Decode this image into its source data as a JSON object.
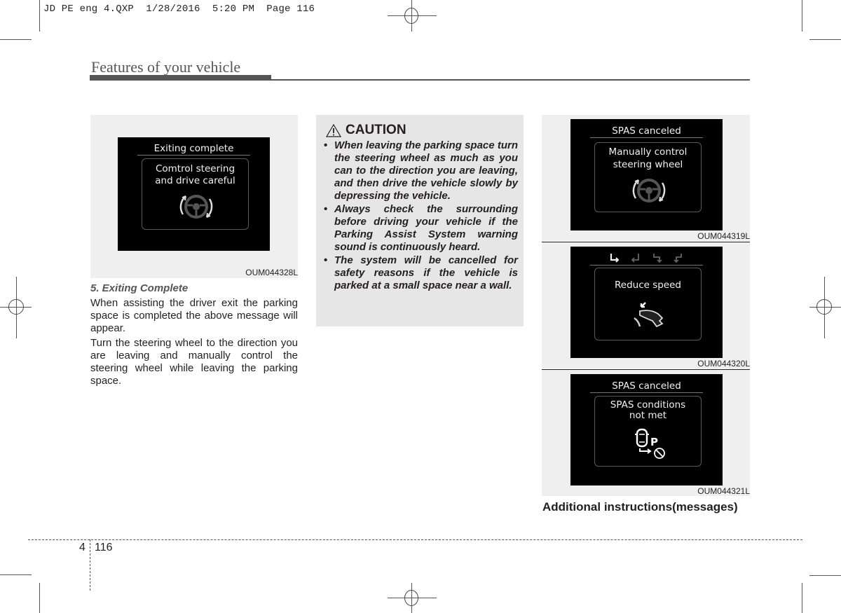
{
  "slug": "JD PE eng 4.QXP  1/28/2016  5:20 PM  Page 116",
  "header": {
    "section_title": "Features of your vehicle"
  },
  "left_column": {
    "figure": {
      "screen_title": "Exiting complete",
      "message_line1": "Comtrol steering",
      "message_line2": "and drive careful",
      "icon": "steering-wheel-rotate-icon",
      "code": "OUM044328L"
    },
    "subheading": "5. Exiting Complete",
    "paragraphs": [
      "When assisting the driver exit the parking space is completed the above message will appear.",
      "Turn the steering wheel to the direction you are leaving and  manually control the steering wheel while leaving the parking space."
    ]
  },
  "caution": {
    "title": "CAUTION",
    "icon": "warning-triangle-icon",
    "items": [
      "When leaving the parking space turn the steering wheel as much as you can to the direction you are leaving, and then drive the vehicle slowly by depressing the vehicle.",
      "Always check the surrounding before driving your vehicle if the Parking Assist System warning sound is continuously heard.",
      "The system will be cancelled for safety reasons if the vehicle is parked at a small space near a wall."
    ]
  },
  "right_column": {
    "figures": [
      {
        "screen_title": "SPAS canceled",
        "message_line1": "Manually control",
        "message_line2": "steering wheel",
        "icon": "steering-wheel-rotate-icon",
        "code": "OUM044319L"
      },
      {
        "screen_title": "",
        "status_icons": [
          "exit-right-arrow-icon",
          "exit-left-arrow-icon",
          "park-right-arrow-icon",
          "park-left-arrow-icon"
        ],
        "message_line1": "Reduce speed",
        "message_line2": "",
        "icon": "brake-pedal-foot-icon",
        "code": "OUM044320L"
      },
      {
        "screen_title": "SPAS canceled",
        "message_line1": "SPAS conditions",
        "message_line2": "not met",
        "icon": "car-park-prohibited-icon",
        "code": "OUM044321L"
      }
    ],
    "caption": "Additional instructions(messages)"
  },
  "footer": {
    "chapter": "4",
    "page": "116"
  }
}
